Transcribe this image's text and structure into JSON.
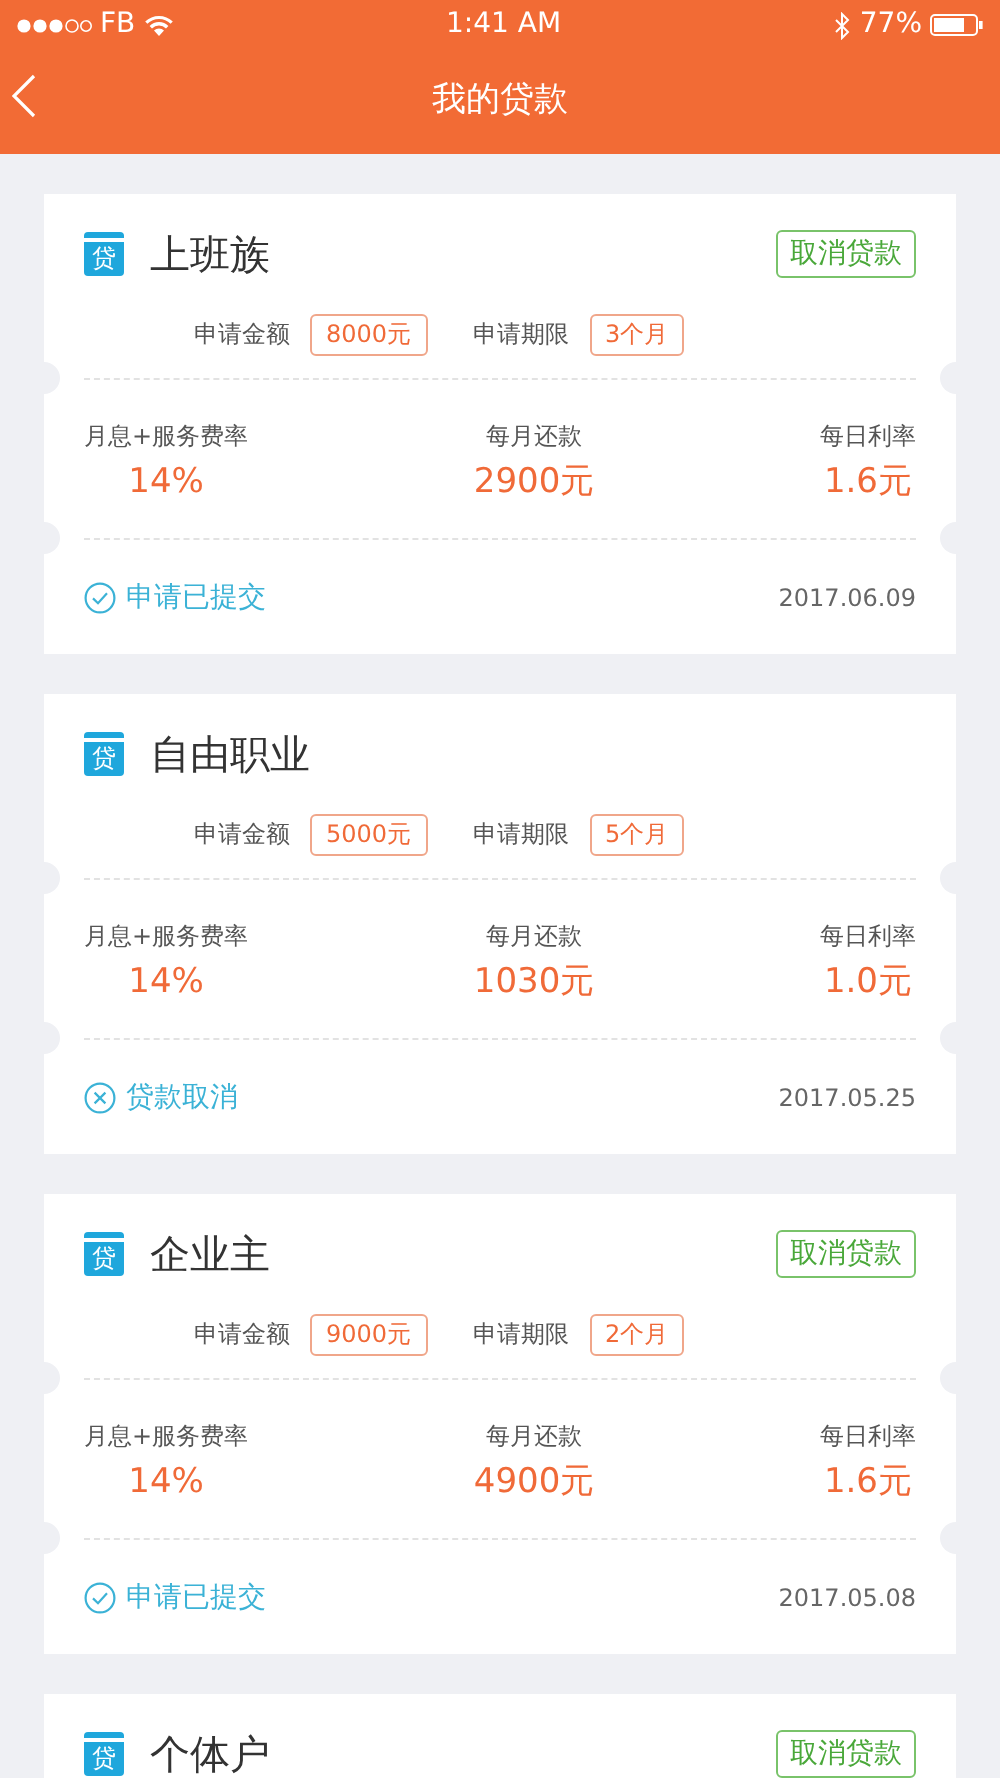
{
  "status_bar": {
    "carrier": "FB",
    "time": "1:41 AM",
    "battery": "77%"
  },
  "nav": {
    "title": "我的贷款"
  },
  "loans": [
    {
      "badge": "贷",
      "title": "上班族",
      "cancel_button": "取消贷款",
      "amount_label": "申请金额",
      "amount": "8000元",
      "term_label": "申请期限",
      "term": "3个月",
      "stats": [
        {
          "label": "月息+服务费率",
          "value": "14%"
        },
        {
          "label": "每月还款",
          "value": "2900元"
        },
        {
          "label": "每日利率",
          "value": "1.6元"
        }
      ],
      "status": {
        "kind": "submitted",
        "text": "申请已提交"
      },
      "date": "2017.06.09"
    },
    {
      "badge": "贷",
      "title": "自由职业",
      "amount_label": "申请金额",
      "amount": "5000元",
      "term_label": "申请期限",
      "term": "5个月",
      "stats": [
        {
          "label": "月息+服务费率",
          "value": "14%"
        },
        {
          "label": "每月还款",
          "value": "1030元"
        },
        {
          "label": "每日利率",
          "value": "1.0元"
        }
      ],
      "status": {
        "kind": "cancelled",
        "text": "贷款取消"
      },
      "date": "2017.05.25"
    },
    {
      "badge": "贷",
      "title": "企业主",
      "cancel_button": "取消贷款",
      "amount_label": "申请金额",
      "amount": "9000元",
      "term_label": "申请期限",
      "term": "2个月",
      "stats": [
        {
          "label": "月息+服务费率",
          "value": "14%"
        },
        {
          "label": "每月还款",
          "value": "4900元"
        },
        {
          "label": "每日利率",
          "value": "1.6元"
        }
      ],
      "status": {
        "kind": "submitted",
        "text": "申请已提交"
      },
      "date": "2017.05.08"
    },
    {
      "badge": "贷",
      "title": "个体户",
      "cancel_button": "取消贷款"
    }
  ]
}
